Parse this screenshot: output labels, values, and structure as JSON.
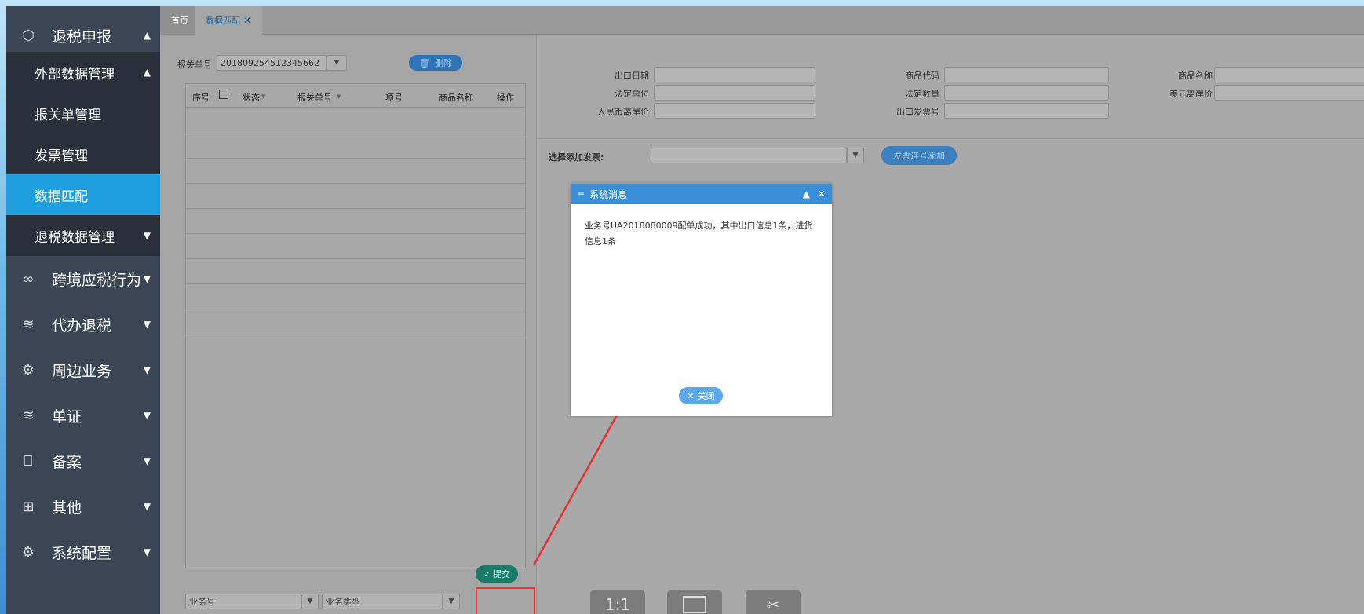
{
  "sidebar": {
    "items": [
      {
        "label": "退税申报",
        "icon": "cube-icon",
        "arrow": "▲"
      },
      {
        "label": "跨境应税行为",
        "icon": "infinity-icon",
        "arrow": "▼"
      },
      {
        "label": "代办退税",
        "icon": "layers-icon",
        "arrow": "▼"
      },
      {
        "label": "周边业务",
        "icon": "gear-icon",
        "arrow": "▼"
      },
      {
        "label": "单证",
        "icon": "layers-icon",
        "arrow": "▼"
      },
      {
        "label": "备案",
        "icon": "book-icon",
        "arrow": "▼"
      },
      {
        "label": "其他",
        "icon": "apps-icon",
        "arrow": "▼"
      },
      {
        "label": "系统配置",
        "icon": "gear-icon",
        "arrow": "▼"
      }
    ],
    "subitems": [
      {
        "label": "外部数据管理",
        "arrow": "▲"
      },
      {
        "label": "报关单管理"
      },
      {
        "label": "发票管理"
      },
      {
        "label": "数据匹配"
      },
      {
        "label": "退税数据管理",
        "arrow": "▼"
      }
    ]
  },
  "tabs": [
    {
      "label": "首页"
    },
    {
      "label": "数据匹配",
      "close": "✕"
    }
  ],
  "left": {
    "customs_label": "报关单号",
    "customs_value": "201809254512345662",
    "delete_label": "删除",
    "columns": [
      "序号",
      "状态",
      "报关单号",
      "项号",
      "商品名称",
      "操作"
    ],
    "business_no_placeholder": "业务号",
    "business_type_placeholder": "业务类型",
    "submit_label": "提交"
  },
  "right": {
    "fields": {
      "export_date": "出口日期",
      "goods_code": "商品代码",
      "goods_name": "商品名称",
      "legal_unit": "法定单位",
      "legal_qty": "法定数量",
      "usd_unit_price": "美元离岸价",
      "rmb_unit_price": "人民币离岸价",
      "export_invoice": "出口发票号"
    },
    "invoice_select_label": "选择添加发票:",
    "invoice_add_button": "发票连号添加"
  },
  "dialog": {
    "title": "系统消息",
    "message": "业务号UA2018080009配单成功，其中出口信息1条，进货信息1条",
    "close_label": "关闭"
  },
  "viewer": {
    "one_to_one": "1:1"
  },
  "colors": {
    "sidebar_bg": "#3c4555",
    "active_item": "#1e9fe0",
    "dialog_header": "#3b8fd9",
    "annotation_red": "#e33333"
  }
}
